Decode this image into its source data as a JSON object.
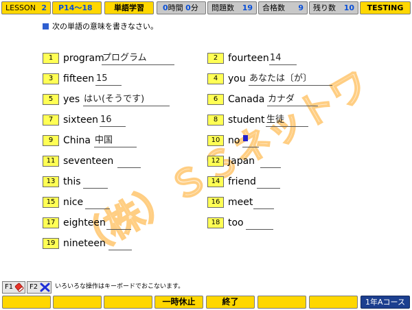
{
  "topbar": {
    "lesson_label": "LESSON",
    "lesson_value": "2",
    "page_range": "P14～18",
    "mode_button": "単語学習",
    "time_hours": "0",
    "time_hours_unit": "時間",
    "time_minutes": "0",
    "time_minutes_unit": "分",
    "questions_label": "問題数",
    "questions_value": "19",
    "passed_label": "合格数",
    "passed_value": "9",
    "remaining_label": "残り数",
    "remaining_value": "10",
    "status_button": "TESTING"
  },
  "instruction": "次の単語の意味を書きなさい。",
  "watermark": "（株）ＳＳネットワーク",
  "questions": [
    {
      "num": "1",
      "word": "program",
      "answer": "プログラム"
    },
    {
      "num": "2",
      "word": "fourteen",
      "answer": "14"
    },
    {
      "num": "3",
      "word": "fifteen",
      "answer": "15"
    },
    {
      "num": "4",
      "word": "you",
      "answer": "あなたは〔が〕"
    },
    {
      "num": "5",
      "word": "yes",
      "answer": "はい(そうです)"
    },
    {
      "num": "6",
      "word": "Canada",
      "answer": "カナダ"
    },
    {
      "num": "7",
      "word": "sixteen",
      "answer": "16"
    },
    {
      "num": "8",
      "word": "student",
      "answer": "生徒"
    },
    {
      "num": "9",
      "word": "China",
      "answer": "中国"
    },
    {
      "num": "10",
      "word": "no",
      "answer": ""
    },
    {
      "num": "11",
      "word": "seventeen",
      "answer": ""
    },
    {
      "num": "12",
      "word": "Japan",
      "answer": ""
    },
    {
      "num": "13",
      "word": "this",
      "answer": ""
    },
    {
      "num": "14",
      "word": "friend",
      "answer": ""
    },
    {
      "num": "15",
      "word": "nice",
      "answer": ""
    },
    {
      "num": "16",
      "word": "meet",
      "answer": ""
    },
    {
      "num": "17",
      "word": "eighteen",
      "answer": ""
    },
    {
      "num": "18",
      "word": "too",
      "answer": ""
    },
    {
      "num": "19",
      "word": "nineteen",
      "answer": ""
    }
  ],
  "function_keys": {
    "f1_label": "F1",
    "f1_icon": "eraser-icon",
    "f2_label": "F2",
    "f2_icon": "x-mark-icon",
    "note": "いろいろな操作はキーボードでおこないます。"
  },
  "bottombar": {
    "pause_button": "一時休止",
    "end_button": "終了",
    "course_button": "1年Aコース"
  },
  "colors": {
    "accent_yellow": "#ffd700",
    "value_blue": "#0a4fd6",
    "course_blue": "#1c3f8f",
    "watermark_orange": "#ffc66e"
  }
}
